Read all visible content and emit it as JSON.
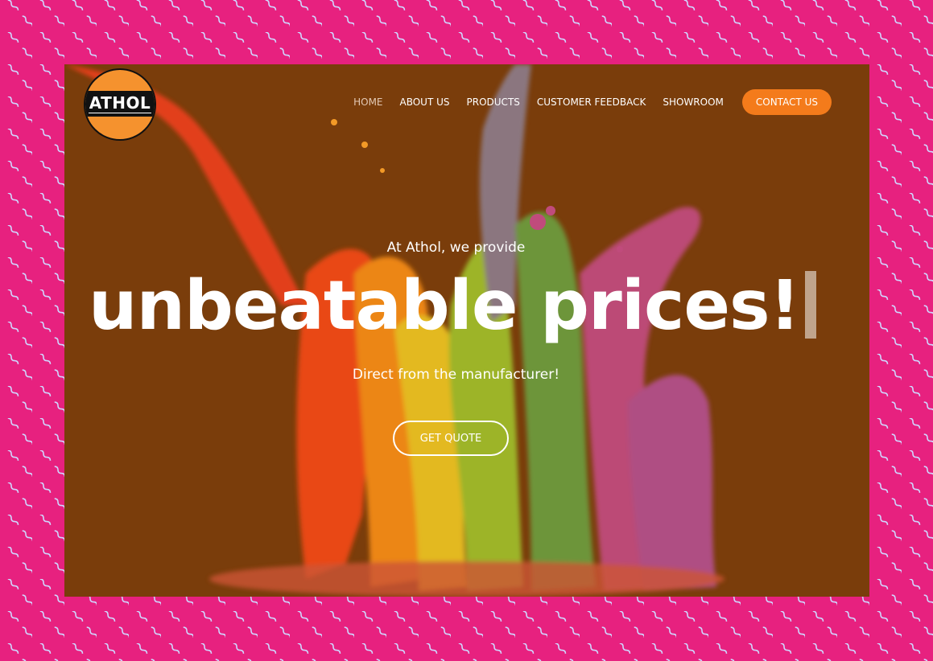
{
  "brand": {
    "logo_text": "ATHOL"
  },
  "nav": {
    "items": [
      {
        "label": "HOME",
        "active": true
      },
      {
        "label": "ABOUT US",
        "active": false
      },
      {
        "label": "PRODUCTS",
        "active": false
      },
      {
        "label": "CUSTOMER FEEDBACK",
        "active": false
      },
      {
        "label": "SHOWROOM",
        "active": false
      }
    ],
    "contact_label": "CONTACT US"
  },
  "hero": {
    "intro": "At Athol, we provide",
    "headline": "unbeatable prices!",
    "subtitle": "Direct from the manufacturer!",
    "cta_label": "GET QUOTE"
  },
  "colors": {
    "page_background": "#e7217f",
    "pattern_stroke": "#cfd7ff",
    "hero_background": "#7a3d0b",
    "accent_orange": "#f47b1b",
    "logo_orange": "#f5922e"
  }
}
